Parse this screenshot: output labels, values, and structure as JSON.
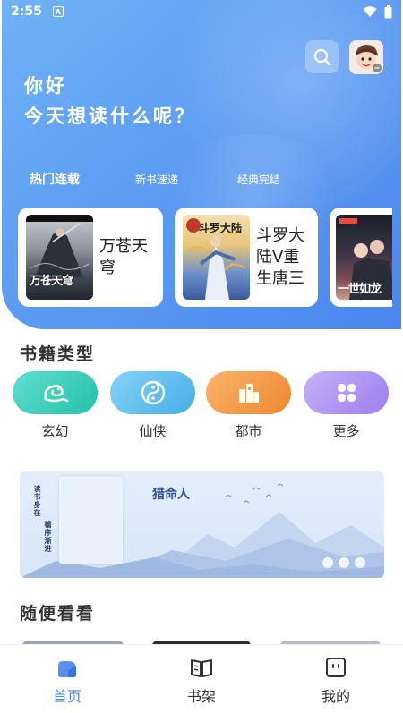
{
  "status_bar": {
    "time": "2:55",
    "notification_letter": "A"
  },
  "header": {
    "greeting": "你好",
    "prompt": "今天想读什么呢？"
  },
  "tabs": [
    {
      "label": "热门连载",
      "active": true
    },
    {
      "label": "新书速递",
      "active": false
    },
    {
      "label": "经典完结",
      "active": false
    }
  ],
  "featured": [
    {
      "title": "万苍天穹",
      "cover_text": "万苍天穹"
    },
    {
      "title": "斗罗大陆V重生唐三",
      "cover_text": "斗罗大陆"
    },
    {
      "title": "",
      "cover_text": "一世如龙"
    }
  ],
  "categories": {
    "title": "书籍类型",
    "items": [
      {
        "label": "玄幻",
        "icon": "dragon-icon",
        "color": "#38c9b6"
      },
      {
        "label": "仙侠",
        "icon": "taiji-icon",
        "color": "#52b6e8"
      },
      {
        "label": "都市",
        "icon": "city-icon",
        "color": "#f2963c"
      },
      {
        "label": "更多",
        "icon": "grid-icon",
        "color": "#a98af0"
      }
    ]
  },
  "banner": {
    "title": "猎命人",
    "side_text_1": "读书身在",
    "side_text_2": "稽序渐进",
    "pages": 3
  },
  "random": {
    "title": "随便看看"
  },
  "bottom_nav": [
    {
      "label": "首页",
      "icon": "home-icon",
      "active": true
    },
    {
      "label": "书架",
      "icon": "bookshelf-icon",
      "active": false
    },
    {
      "label": "我的",
      "icon": "profile-icon",
      "active": false
    }
  ],
  "colors": {
    "accent": "#4d86ee",
    "hero_top": "#6fb2f5",
    "hero_bottom": "#4a86ee"
  }
}
